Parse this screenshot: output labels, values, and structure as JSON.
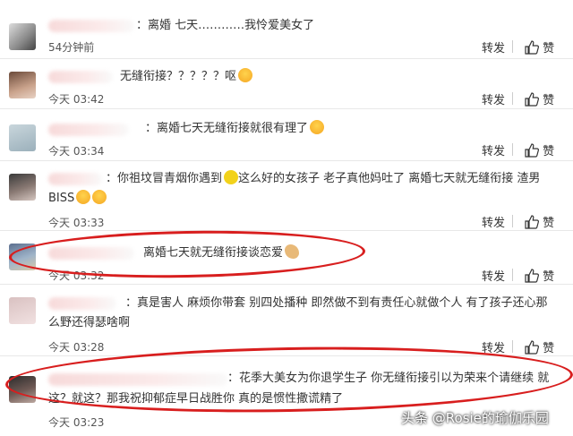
{
  "comments": [
    {
      "text": "：离婚 七天…………我怜爱美女了",
      "time": "54分钟前"
    },
    {
      "text": "无缝衔接？？？？？呕",
      "time": "今天 03:42"
    },
    {
      "text": "：离婚七天无缝衔接就很有理了",
      "time": "今天 03:34"
    },
    {
      "text_line1": "：你祖坟冒青烟你遇到",
      "text_line1b": "这么好的女孩子 老子真他妈吐了 离婚七天就无缝衔接 渣男",
      "text_line2": "BISS",
      "time": "今天 03:33"
    },
    {
      "text": "离婚七天就无缝衔接谈恋爱",
      "time": "今天 03:32"
    },
    {
      "text_line1": "：真是害人 麻烦你带套 别四处播种 即然做不到有责任心就做个人 有了孩子还心那",
      "text_line2": "么野还得瑟啥啊",
      "time": "今天 03:28"
    },
    {
      "text_line1": "：花季大美女为你退学生子 你无缝衔接引以为荣来个请继续 就",
      "text_line2": "这？就这？那我祝抑郁症早日战胜你 真的是惯性撒谎精了",
      "time": "今天 03:23"
    }
  ],
  "actions": {
    "repost": "转发",
    "like": "赞"
  },
  "watermark": "头条 @Rosie的瑜伽乐园",
  "colors": {
    "annotation": "#d81e1e",
    "link": "#333333"
  }
}
